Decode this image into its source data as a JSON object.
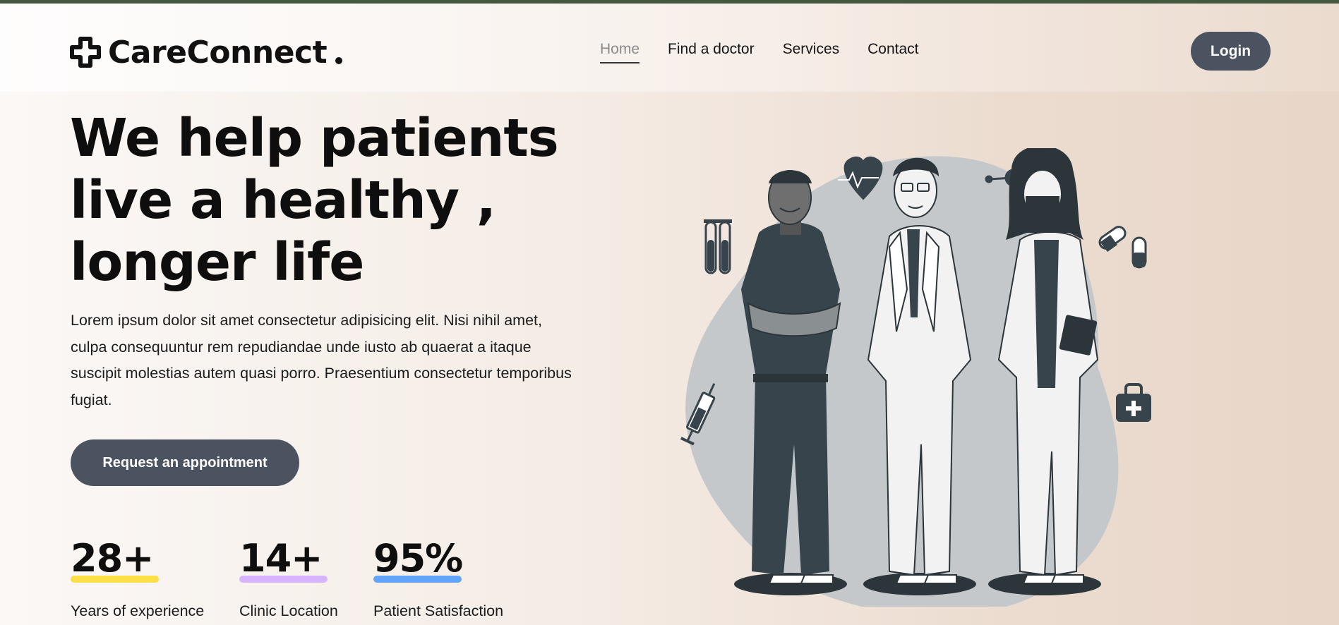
{
  "brand": {
    "name": "CareConnect"
  },
  "nav": {
    "items": [
      {
        "label": "Home",
        "active": true
      },
      {
        "label": "Find a doctor",
        "active": false
      },
      {
        "label": "Services",
        "active": false
      },
      {
        "label": "Contact",
        "active": false
      }
    ],
    "login_label": "Login"
  },
  "hero": {
    "title_lines": [
      "We help patients",
      "live a healthy ,",
      "longer life"
    ],
    "description": "Lorem ipsum dolor sit amet consectetur adipisicing elit. Nisi nihil amet, culpa consequuntur rem repudiandae unde iusto ab quaerat a itaque suscipit molestias autem quasi porro. Praesentium consectetur temporibus fugiat.",
    "cta_label": "Request an appointment"
  },
  "stats": [
    {
      "value": "28+",
      "label": "Years of experience",
      "color": "#fde047"
    },
    {
      "value": "14+",
      "label": "Clinic Location",
      "color": "#d8b4fe"
    },
    {
      "value": "95%",
      "label": "Patient Satisfaction",
      "color": "#60a5fa"
    }
  ],
  "colors": {
    "accent": "#4b5260",
    "top_strip": "#44573f",
    "illustration_dark": "#37444b",
    "illustration_blob": "#c4c8ca"
  },
  "icons": [
    "plus-logo-icon",
    "heart-pulse-icon",
    "molecule-icon",
    "test-tubes-icon",
    "syringe-icon",
    "pill-icon",
    "first-aid-kit-icon"
  ]
}
